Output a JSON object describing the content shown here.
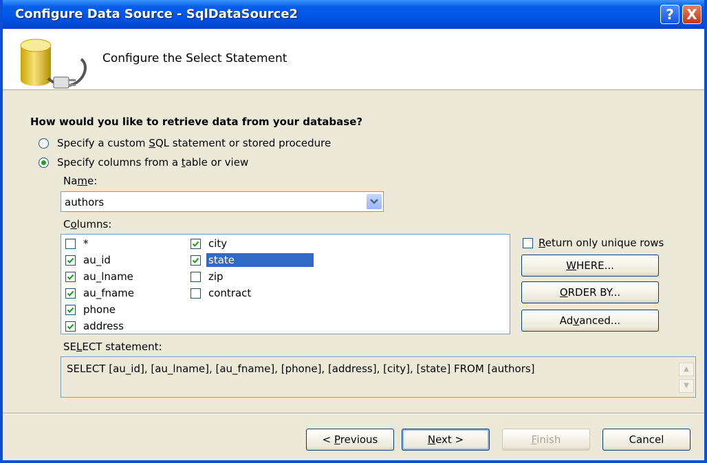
{
  "window": {
    "title": "Configure Data Source - SqlDataSource2",
    "help_glyph": "?",
    "close_glyph": "X"
  },
  "header": {
    "title": "Configure the Select Statement",
    "icon": "database-plug-icon"
  },
  "question": "How would you like to retrieve data from your database?",
  "options": {
    "custom_sql": {
      "pre": "Specify a custom ",
      "u": "S",
      "post": "QL statement or stored procedure",
      "selected": false
    },
    "columns_from_table": {
      "pre": "Specify columns from a ",
      "u": "t",
      "post": "able or view",
      "selected": true
    }
  },
  "name_label": {
    "pre": "Na",
    "u": "m",
    "post": "e:"
  },
  "name_value": "authors",
  "columns_label": {
    "pre": "C",
    "u": "o",
    "post": "lumns:"
  },
  "columns": [
    {
      "label": "*",
      "checked": false
    },
    {
      "label": "au_id",
      "checked": true
    },
    {
      "label": "au_lname",
      "checked": true
    },
    {
      "label": "au_fname",
      "checked": true
    },
    {
      "label": "phone",
      "checked": true
    },
    {
      "label": "address",
      "checked": true
    },
    {
      "label": "city",
      "checked": true
    },
    {
      "label": "state",
      "checked": true,
      "selected": true
    },
    {
      "label": "zip",
      "checked": false
    },
    {
      "label": "contract",
      "checked": false
    }
  ],
  "unique_rows": {
    "pre": "",
    "u": "R",
    "post": "eturn only unique rows",
    "checked": false
  },
  "buttons": {
    "where": {
      "pre": "",
      "u": "W",
      "post": "HERE..."
    },
    "order_by": {
      "pre": "",
      "u": "O",
      "post": "RDER BY..."
    },
    "advanced": {
      "pre": "Ad",
      "u": "v",
      "post": "anced..."
    },
    "previous": {
      "pre": "< ",
      "u": "P",
      "post": "revious"
    },
    "next": {
      "pre": "",
      "u": "N",
      "post": "ext >"
    },
    "finish": {
      "pre": "",
      "u": "F",
      "post": "inish",
      "disabled": true
    },
    "cancel": {
      "pre": "Cancel",
      "u": "",
      "post": ""
    }
  },
  "select_label": {
    "pre": "SE",
    "u": "L",
    "post": "ECT statement:"
  },
  "select_statement": "SELECT [au_id], [au_lname], [au_fname], [phone], [address], [city], [state] FROM [authors]",
  "colors": {
    "titlebar": "#0055e5",
    "selection": "#316ac5",
    "check": "#21a121",
    "face": "#ece9d8"
  }
}
